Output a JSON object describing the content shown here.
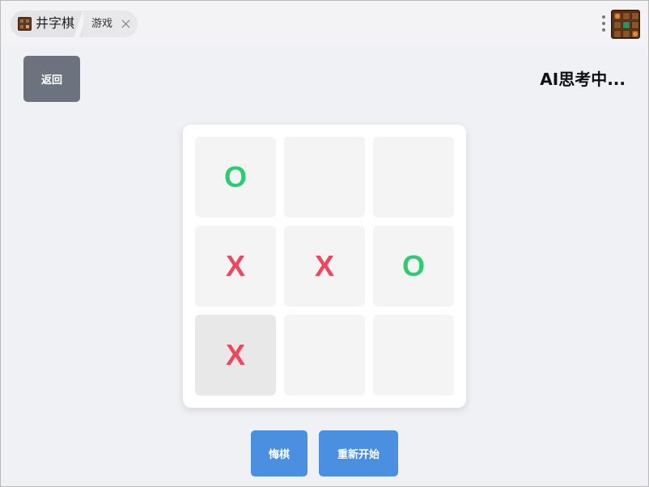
{
  "window": {
    "tab_title": "井字棋",
    "tab_subtitle": "游戏"
  },
  "header": {
    "back_label": "返回",
    "status_text": "AI思考中..."
  },
  "board": {
    "cells": [
      {
        "mark": "O",
        "last": false
      },
      {
        "mark": "",
        "last": false
      },
      {
        "mark": "",
        "last": false
      },
      {
        "mark": "X",
        "last": false
      },
      {
        "mark": "X",
        "last": false
      },
      {
        "mark": "O",
        "last": false
      },
      {
        "mark": "X",
        "last": true
      },
      {
        "mark": "",
        "last": false
      },
      {
        "mark": "",
        "last": false
      }
    ]
  },
  "actions": {
    "undo_label": "悔棋",
    "restart_label": "重新开始"
  },
  "colors": {
    "x_mark": "#f0455c",
    "o_mark": "#2ecc71",
    "primary_button": "#4a8fe0",
    "back_button": "#6c737e",
    "cell_empty": "#f4f4f4",
    "cell_last_move": "#e8e8e8"
  },
  "icons": {
    "tab_icon": "tic-tac-toe-board-icon",
    "close": "close-icon",
    "menu": "more-vertical-icon",
    "app": "tic-tac-toe-app-icon"
  }
}
